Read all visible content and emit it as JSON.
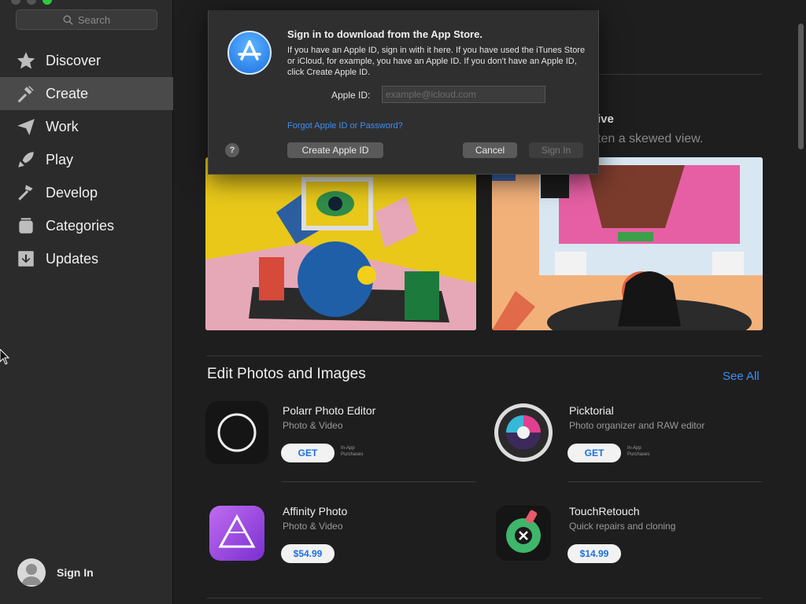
{
  "sidebar": {
    "search_placeholder": "Search",
    "items": [
      {
        "label": "Discover",
        "icon": "star-icon"
      },
      {
        "label": "Create",
        "icon": "hammer-brush-icon"
      },
      {
        "label": "Work",
        "icon": "paper-plane-icon"
      },
      {
        "label": "Play",
        "icon": "rocket-icon"
      },
      {
        "label": "Develop",
        "icon": "hammer-icon"
      },
      {
        "label": "Categories",
        "icon": "stack-icon"
      },
      {
        "label": "Updates",
        "icon": "download-icon"
      }
    ],
    "active_item": "Create",
    "sign_in_label": "Sign In"
  },
  "main": {
    "story": {
      "title": "ive",
      "subtitle": "ten a skewed view."
    },
    "section": {
      "title": "Edit Photos and Images",
      "see_all": "See All"
    },
    "apps": [
      {
        "name": "Polarr Photo Editor",
        "category": "Photo & Video",
        "action": "GET",
        "note": "In-App Purchases"
      },
      {
        "name": "Picktorial",
        "category": "Photo organizer and RAW editor",
        "action": "GET",
        "note": "In-App Purchases"
      },
      {
        "name": "Affinity Photo",
        "category": "Photo & Video",
        "action": "$54.99"
      },
      {
        "name": "TouchRetouch",
        "category": "Quick repairs and cloning",
        "action": "$14.99"
      }
    ]
  },
  "dialog": {
    "title": "Sign in to download from the App Store.",
    "body": "If you have an Apple ID, sign in with it here. If you have used the iTunes Store or iCloud, for example, you have an Apple ID. If you don't have an Apple ID, click Create Apple ID.",
    "apple_id_label": "Apple ID:",
    "apple_id_placeholder": "example@icloud.com",
    "forgot_link": "Forgot Apple ID or Password?",
    "help_label": "?",
    "create_button": "Create Apple ID",
    "cancel_button": "Cancel",
    "signin_button": "Sign In"
  },
  "colors": {
    "accent": "#3d8ef7",
    "sidebar_bg": "#2b2b2b",
    "main_bg": "#1e1e1e",
    "active_item_bg": "#4a4a4a"
  }
}
